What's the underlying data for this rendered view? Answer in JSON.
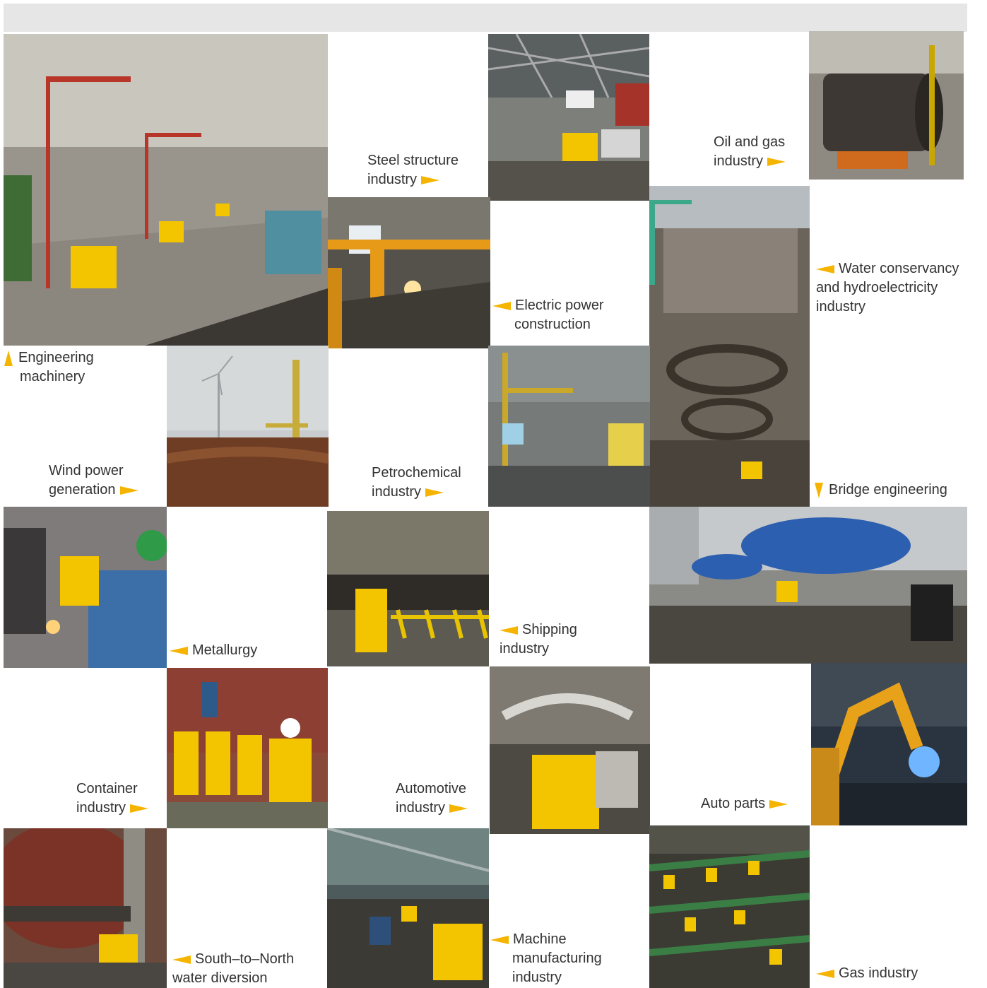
{
  "captions": {
    "engineering_machinery": [
      "Engineering",
      "machinery"
    ],
    "steel_structure": [
      "Steel structure",
      "industry"
    ],
    "oil_gas": [
      "Oil and gas",
      "industry"
    ],
    "electric_power": [
      "Electric power",
      "construction"
    ],
    "water_conservancy": [
      "Water conservancy",
      "and hydroelectricity",
      "industry"
    ],
    "wind_power": [
      "Wind power",
      "generation"
    ],
    "petrochemical": [
      "Petrochemical",
      "industry"
    ],
    "bridge": [
      "Bridge engineering"
    ],
    "metallurgy": [
      "Metallurgy"
    ],
    "shipping": [
      "Shipping",
      "industry"
    ],
    "container": [
      "Container",
      "industry"
    ],
    "automotive": [
      "Automotive",
      "industry"
    ],
    "auto_parts": [
      "Auto parts"
    ],
    "south_north": [
      "South–to–North",
      "water diversion"
    ],
    "machine_manufacturing": [
      "Machine",
      "manufacturing",
      "industry"
    ],
    "gas": [
      "Gas industry"
    ]
  },
  "colors": {
    "accent": "#f5b400",
    "text": "#333333",
    "header": "#e6e6e6"
  },
  "icons": {
    "pointer": "triangle-pointer-icon"
  }
}
